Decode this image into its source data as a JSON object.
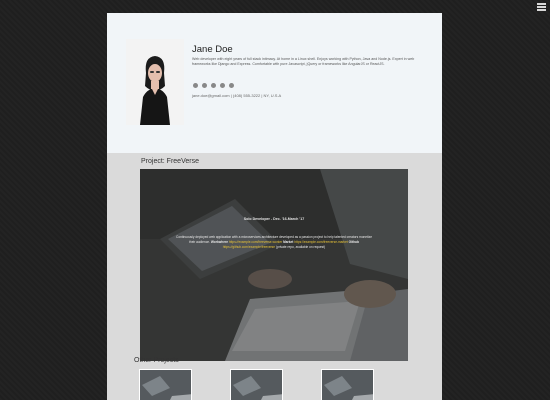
{
  "profile": {
    "name": "Jane Doe",
    "bio": "Web developer with eight years of full stack intimacy. At home in a Linux shell. Enjoys working with Python, Java and Node.js. Expert in web frameworks like Django and Express. Comfortable with pure Javascript, jQuery or frameworks like AngularJS or ReactJS.",
    "contact": "jane.doe@gmail.com | (408) 555-3222 | NY, U.S.A",
    "social_icons": [
      "github-icon",
      "linkedin-icon",
      "stack-overflow-icon",
      "chat-icon",
      "settings-icon"
    ]
  },
  "project": {
    "title": "Project: FreeVerse",
    "role": "Solo Developer - Dec. '16-March '17",
    "desc_start": "Continuously deployed web application with a microservices architecture developed as a passion project to help talented creators monetize their audience.",
    "worker_label": "Workwhere",
    "worker_url": "https://example.com/freeverse-worker",
    "market_label": "Market",
    "market_url": "https://example.com/freeverse-market",
    "github_label": "Github",
    "github_url": "https://github.com/example/freeverse",
    "note": "(private repo, available on request)"
  },
  "other_projects": {
    "title": "Other Projects",
    "count": 3
  },
  "colors": {
    "page": "#dadada",
    "profile_bg": "#f1f5f8",
    "link": "#e6c238",
    "background": "#1f1f1f"
  }
}
